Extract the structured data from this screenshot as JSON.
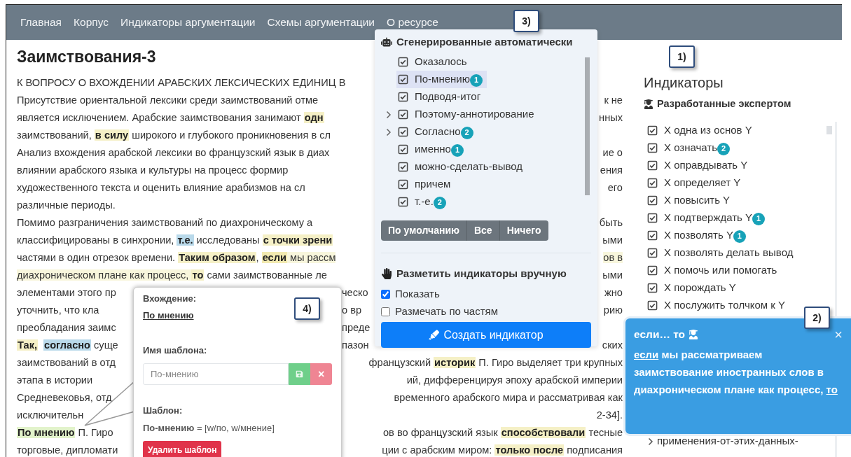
{
  "nav": {
    "links": [
      "Главная",
      "Корпус",
      "Индикаторы аргументации",
      "Схемы аргументации",
      "О ресурсе"
    ]
  },
  "article": {
    "title": "Заимствования-3",
    "lines": [
      {
        "kind": "single",
        "parts": [
          [
            {
              "kind": "plain",
              "text": "К ВОПРОСУ О ВХОЖДЕНИИ АРАБСКИХ ЛЕКСИЧЕСКИХ ЕДИНИЦ В"
            }
          ]
        ]
      },
      {
        "kind": "split",
        "parts": [
          [
            {
              "kind": "plain",
              "text": "Присутствие ориентальной лексики среди заимствований отме"
            }
          ],
          [
            {
              "kind": "plain",
              "text": "к не"
            }
          ]
        ]
      },
      {
        "kind": "split",
        "parts": [
          [
            {
              "kind": "plain",
              "text": "является исключением. Арабские заимствования занимают "
            },
            {
              "kind": "mark",
              "text": "одн",
              "color": "#f5f0c6"
            }
          ],
          [
            {
              "kind": "plain",
              "text": "нных"
            }
          ]
        ]
      },
      {
        "kind": "single",
        "parts": [
          [
            {
              "kind": "plain",
              "text": "заимствований, "
            },
            {
              "kind": "mark",
              "text": "в силу",
              "color": "#f5f0c6"
            },
            {
              "kind": "plain",
              "text": " широкого и глубокого проникновения в сл"
            }
          ]
        ]
      },
      {
        "kind": "split",
        "parts": [
          [
            {
              "kind": "plain",
              "text": "Анализ вхождения арабской лексики во французский язык в диах"
            }
          ],
          [
            {
              "kind": "plain",
              "text": "ие о"
            }
          ]
        ]
      },
      {
        "kind": "split",
        "parts": [
          [
            {
              "kind": "plain",
              "text": "влиянии арабского языка и культуры на процесс формир"
            }
          ],
          [
            {
              "kind": "plain",
              "text": "ения"
            }
          ]
        ]
      },
      {
        "kind": "split",
        "parts": [
          [
            {
              "kind": "plain",
              "text": "художественного текста и оценить влияние арабизмов на сл"
            }
          ],
          [
            {
              "kind": "plain",
              "text": "его"
            }
          ]
        ]
      },
      {
        "kind": "single",
        "parts": [
          [
            {
              "kind": "plain",
              "text": "различные периоды."
            }
          ]
        ]
      },
      {
        "kind": "split",
        "parts": [
          [
            {
              "kind": "plain",
              "text": "Помимо разграничения заимствований по диахроническому а"
            }
          ],
          [
            {
              "kind": "plain",
              "text": "быть"
            }
          ]
        ]
      },
      {
        "kind": "split",
        "parts": [
          [
            {
              "kind": "plain",
              "text": "классифицированы в синхронии, "
            },
            {
              "kind": "mark",
              "text": "т.е.",
              "color": "#b9d9ea"
            },
            {
              "kind": "plain",
              "text": " исследованы "
            },
            {
              "kind": "mark",
              "text": "с точки зрени",
              "color": "#f5f0c6"
            }
          ],
          [
            {
              "kind": "plain",
              "text": "ыми"
            }
          ]
        ]
      },
      {
        "kind": "split",
        "parts": [
          [
            {
              "kind": "plain",
              "text": "частями в один отрезок времени. "
            },
            {
              "kind": "mark",
              "text": "Таким образом",
              "color": "#f5f0c6"
            },
            {
              "kind": "plain",
              "text": ", "
            },
            {
              "kind": "mark",
              "text": "если",
              "color": "#f2eab0"
            },
            {
              "kind": "span",
              "text": " мы рассм",
              "color": "#f8f6dc"
            }
          ],
          [
            {
              "kind": "span",
              "text": "ов в",
              "color": "#f8f6dc"
            }
          ]
        ]
      },
      {
        "kind": "split",
        "parts": [
          [
            {
              "kind": "span",
              "text": "диахроническом плане как процесс, ",
              "color": "#f8f6dc"
            },
            {
              "kind": "mark",
              "text": "то",
              "color": "#f5f0c6"
            },
            {
              "kind": "plain",
              "text": " сами заимствованные ле"
            }
          ],
          [
            {
              "kind": "plain",
              "text": "ыми"
            }
          ]
        ]
      },
      {
        "kind": "triple",
        "parts": [
          [
            {
              "kind": "plain",
              "text": "элементами этого пр"
            }
          ],
          [
            {
              "kind": "plain",
              "text": "ческо"
            }
          ],
          [
            {
              "kind": "plain",
              "text": "жно"
            }
          ]
        ]
      },
      {
        "kind": "triple",
        "parts": [
          [
            {
              "kind": "plain",
              "text": "уточнить, что кла"
            }
          ],
          [
            {
              "kind": "plain",
              "text": "о вр"
            }
          ],
          [
            {
              "kind": "plain",
              "text": "рию"
            }
          ]
        ]
      },
      {
        "kind": "triple",
        "parts": [
          [
            {
              "kind": "plain",
              "text": "преобладания заимс"
            }
          ],
          [
            {
              "kind": "plain",
              "text": "преде"
            }
          ]
        ]
      },
      {
        "kind": "triple",
        "parts": [
          [
            {
              "kind": "mark",
              "text": "Так,",
              "color": "#f5f0c6"
            },
            {
              "kind": "mark",
              "text": "согласно",
              "color": "#b9d9ea"
            },
            {
              "kind": "plain",
              "text": " суще"
            }
          ],
          [
            {
              "kind": "plain",
              "text": "пазон"
            }
          ],
          [
            {
              "kind": "plain",
              "text": "ских"
            }
          ]
        ]
      },
      {
        "kind": "split",
        "parts": [
          [
            {
              "kind": "plain",
              "text": "заимствований в отд"
            }
          ],
          [
            {
              "kind": "plain",
              "text": "французский "
            },
            {
              "kind": "mark",
              "text": "историк",
              "color": "#f5f0c6"
            },
            {
              "kind": "plain",
              "text": " П. Гиро выделяет три крупных"
            }
          ]
        ]
      },
      {
        "kind": "split",
        "parts": [
          [
            {
              "kind": "plain",
              "text": "этапа в истории"
            }
          ],
          [
            {
              "kind": "plain",
              "text": "ий, дифференцируя эпоху арабской империи"
            }
          ]
        ]
      },
      {
        "kind": "split",
        "parts": [
          [
            {
              "kind": "plain",
              "text": "Средневековья, отд"
            }
          ],
          [
            {
              "kind": "plain",
              "text": "временного арабского мира и рассматривая как"
            }
          ]
        ]
      },
      {
        "kind": "split",
        "parts": [
          [
            {
              "kind": "plain",
              "text": "исключительн"
            }
          ],
          [
            {
              "kind": "plain",
              "text": "2-34]."
            }
          ]
        ]
      },
      {
        "kind": "split",
        "parts": [
          [
            {
              "kind": "mark",
              "text": "По мнению",
              "color": "#e2f3cb"
            },
            {
              "kind": "plain",
              "text": " П. Гиро"
            }
          ],
          [
            {
              "kind": "plain",
              "text": "ов во французский язык "
            },
            {
              "kind": "mark",
              "text": "способствовали",
              "color": "#f5f0c6"
            },
            {
              "kind": "plain",
              "text": " тесные"
            }
          ]
        ]
      },
      {
        "kind": "split",
        "parts": [
          [
            {
              "kind": "plain",
              "text": "торговые, дипломати"
            }
          ],
          [
            {
              "kind": "plain",
              "text": "ции с арабским миром: "
            },
            {
              "kind": "mark",
              "text": "только после",
              "color": "#f5f0c6"
            },
            {
              "kind": "plain",
              "text": " подписания"
            }
          ]
        ]
      }
    ]
  },
  "sidebar": {
    "title": "Индикаторы",
    "section": "Разработанные экспертом",
    "items": [
      {
        "label": "Х одна из основ Y",
        "checked": true
      },
      {
        "label": "Х означать",
        "badge": "2",
        "checked": true
      },
      {
        "label": "Х оправдывать Y",
        "checked": true
      },
      {
        "label": "Х определяет Y",
        "checked": true
      },
      {
        "label": "Х повысить Y",
        "checked": true
      },
      {
        "label": "Х подтверждать Y",
        "badge": "1",
        "checked": true
      },
      {
        "label": "Х позволять Y",
        "badge": "1",
        "checked": true
      },
      {
        "label": "Х позволять делать вывод",
        "checked": true
      },
      {
        "label": "Х помочь или помогать",
        "checked": true
      },
      {
        "label": "Х порождать Y",
        "checked": true
      },
      {
        "label": "Х послужить толчком к Y",
        "checked": true
      }
    ],
    "lower_items": [
      {
        "label": "применения-от-этих-данных-"
      }
    ]
  },
  "generated_panel": {
    "title": "Сгенерированные автоматически",
    "items": [
      {
        "label": "Оказалось",
        "kind": "leaf",
        "checked": true,
        "selected": false
      },
      {
        "label": "По-мнению",
        "badge": "1",
        "kind": "leaf",
        "checked": true,
        "selected": true
      },
      {
        "label": "Подводя-итог",
        "kind": "leaf",
        "checked": true,
        "selected": false
      },
      {
        "label": "Поэтому-аннотирование",
        "kind": "group",
        "checked": true,
        "selected": false
      },
      {
        "label": "Согласно",
        "badge": "2",
        "kind": "group",
        "checked": true,
        "selected": false
      },
      {
        "label": "именно",
        "badge": "1",
        "kind": "leaf",
        "checked": true,
        "selected": false
      },
      {
        "label": "можно-сделать-вывод",
        "kind": "leaf",
        "checked": true,
        "selected": false
      },
      {
        "label": "причем",
        "kind": "leaf",
        "checked": true,
        "selected": false
      },
      {
        "label": "т.-е.",
        "badge": "2",
        "kind": "leaf",
        "checked": true,
        "selected": false
      }
    ],
    "buttons": [
      "По умолчанию",
      "Все",
      "Ничего"
    ],
    "manual_title": "Разметить индикаторы вручную",
    "options": [
      {
        "label": "Показать",
        "checked": true
      },
      {
        "label": "Размечать по частям",
        "checked": false
      }
    ],
    "create_button": "Создать индикатор"
  },
  "indicator_popup": {
    "title": "если… то",
    "close": "×",
    "body": [
      {
        "kind": "link",
        "text": "если"
      },
      {
        "kind": "plain",
        "text": " мы рассматриваем заимствование иностранных слов в диахроническом плане как процесс, "
      },
      {
        "kind": "link",
        "text": "то"
      }
    ]
  },
  "template_popup": {
    "occurrence_label": "Вхождение:",
    "occurrence": "По мнению",
    "name_label": "Имя шаблона:",
    "name_placeholder": "По-мнению",
    "close": "×",
    "template_label": "Шаблон:",
    "template": "**По-мнению** = [w/по, w/мнение]",
    "delete_button": "Удалить шаблон"
  },
  "callouts": [
    "1)",
    "2)",
    "3)",
    "4)"
  ]
}
